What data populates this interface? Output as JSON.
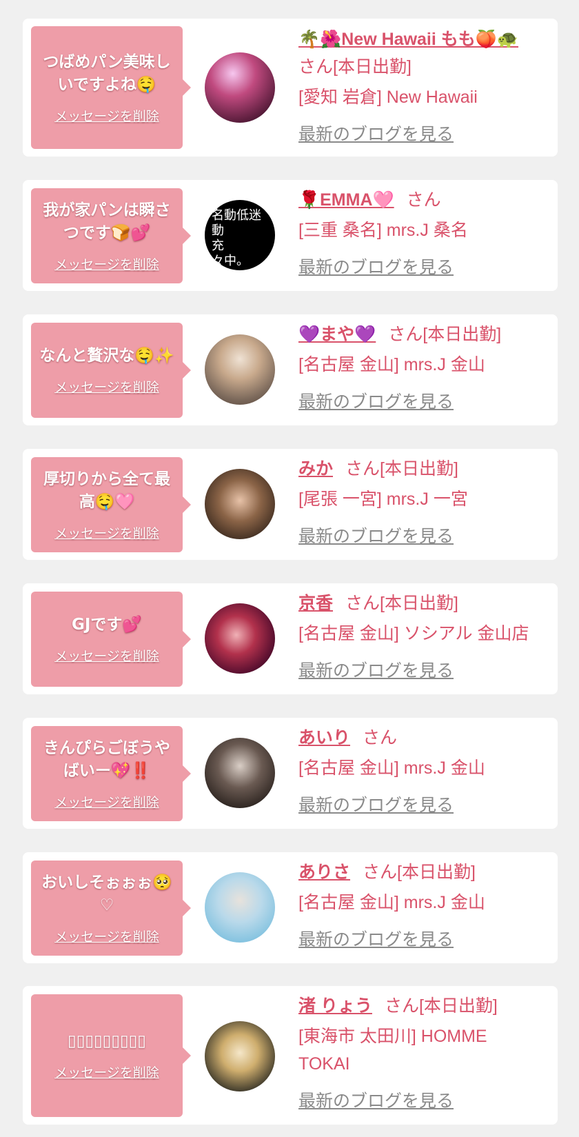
{
  "delete_label": "メッセージを削除",
  "blog_label": "最新のブログを見る",
  "cards": [
    {
      "message": "つばめパン美味しいですよね🤤",
      "name": "🌴🌺New Hawaii もも🍑🐢",
      "suffix": "さん[本日出勤]",
      "shop": "[愛知 岩倉] New Hawaii",
      "avatar_icon": "photo-pink-dress"
    },
    {
      "message": "我が家パンは瞬さつです🍞💕",
      "name": "🌹EMMA🩷",
      "suffix": "さん",
      "shop": "[三重 桑名] mrs.J 桑名",
      "avatar_icon": "text-image",
      "avatar_text": "名動低迷\n動\n充\n々中。"
    },
    {
      "message": "なんと贅沢な🤤✨",
      "name": "💜まや💜",
      "suffix": "さん[本日出勤]",
      "shop": "[名古屋 金山] mrs.J 金山",
      "avatar_icon": "photo-blonde"
    },
    {
      "message": "厚切りから全て最高🤤🩷",
      "name": "みか",
      "suffix": "さん[本日出勤]",
      "shop": "[尾張 一宮] mrs.J 一宮",
      "avatar_icon": "photo-portrait"
    },
    {
      "message": "GJです💕",
      "name": "京香",
      "suffix": "さん[本日出勤]",
      "shop": "[名古屋 金山] ソシアル 金山店",
      "avatar_icon": "photo-kimono"
    },
    {
      "message": "きんぴらごぼうやばいー💖‼️",
      "name": "あいり",
      "suffix": "さん",
      "shop": "[名古屋 金山] mrs.J 金山",
      "avatar_icon": "photo-dark-hair"
    },
    {
      "message": "おいしそぉぉぉ🥺♡",
      "name": "ありさ",
      "suffix": "さん[本日出勤]",
      "shop": "[名古屋 金山] mrs.J 金山",
      "avatar_icon": "photo-cap"
    },
    {
      "message": "▯▯▯▯▯▯▯▯▯",
      "name": "渚 りょう",
      "suffix": "さん[本日出勤]",
      "shop": "[東海市 太田川] HOMME TOKAI",
      "avatar_icon": "photo-magazine"
    }
  ]
}
